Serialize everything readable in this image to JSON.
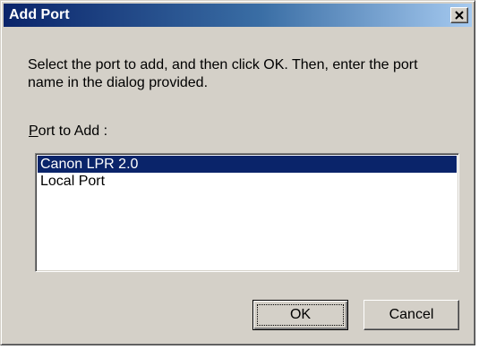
{
  "dialog": {
    "title": "Add Port",
    "instruction": "Select the port to add, and then click OK. Then, enter the port name in the dialog provided.",
    "list_label_accel": "P",
    "list_label_rest": "ort to Add :",
    "ports": [
      "Canon LPR 2.0",
      "Local Port"
    ],
    "selected_port": "Canon LPR 2.0",
    "ok_label": "OK",
    "cancel_label": "Cancel"
  },
  "icons": {
    "close": "close-icon"
  },
  "colors": {
    "title_bar_start": "#0a246a",
    "title_bar_end": "#a6caf0",
    "face": "#d4d0c8",
    "selection": "#0a246a"
  }
}
